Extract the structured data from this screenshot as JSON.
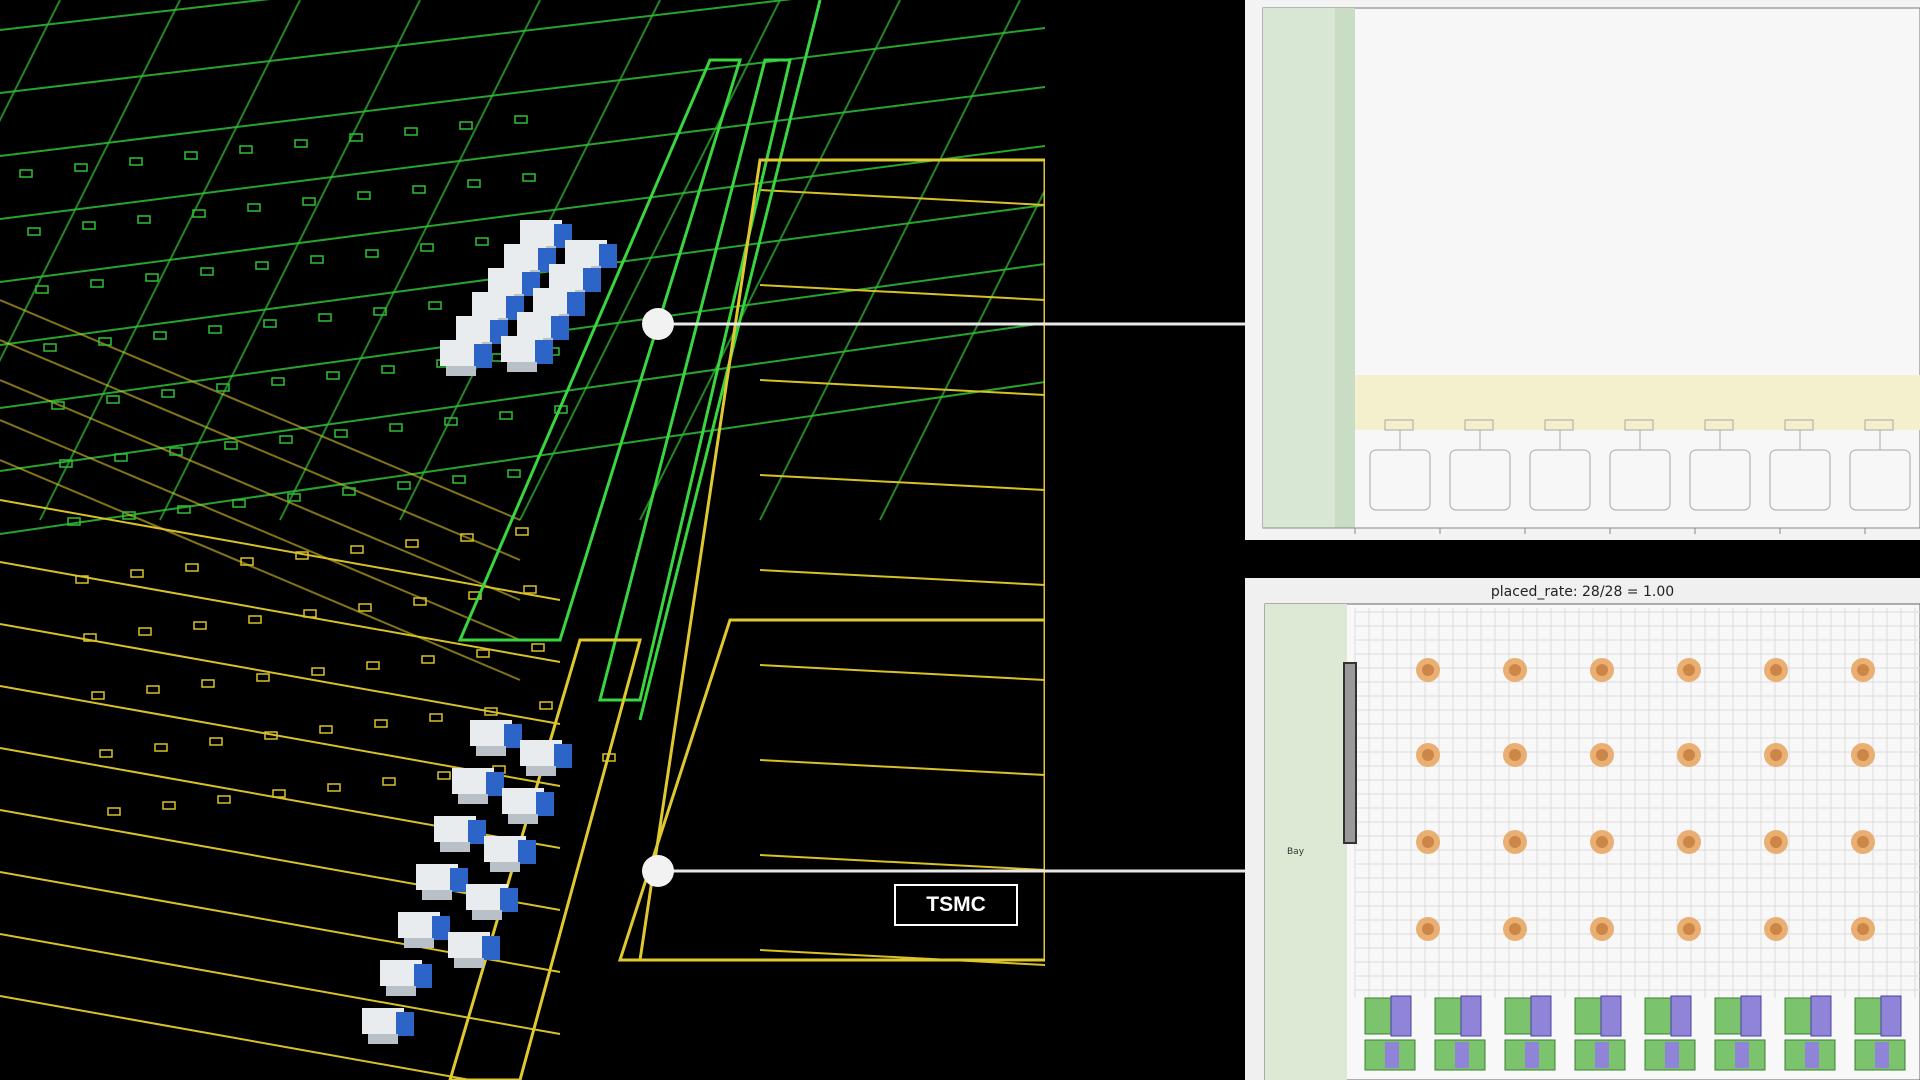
{
  "callout": {
    "label": "TSMC"
  },
  "top_panel": {
    "title": ""
  },
  "bottom_panel": {
    "title": "placed_rate: 28/28 = 1.00",
    "side_label": "Bay"
  },
  "colors": {
    "background": "#000000",
    "green_lines": "#33c43a",
    "yellow_lines": "#d9c22a",
    "panel_bg": "#f0f0f0",
    "chair_orange": "#e7a15a",
    "block_green": "#7cc36d",
    "block_purple": "#8f84d8"
  }
}
